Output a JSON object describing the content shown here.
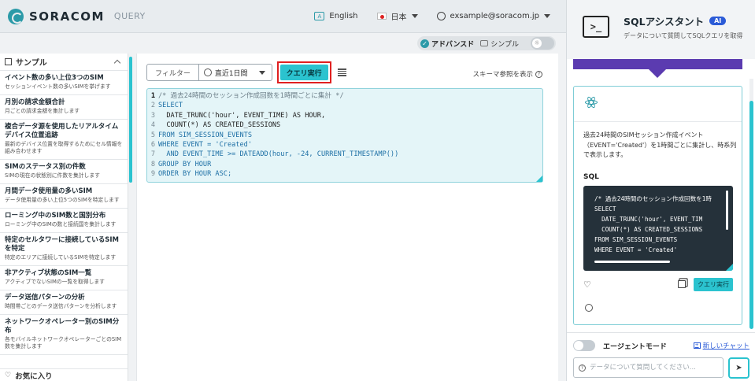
{
  "header": {
    "brand": "SORACOM",
    "product": "QUERY",
    "language": "English",
    "region": "日本",
    "user": "exsample@soracom.jp"
  },
  "mode": {
    "advanced_label": "アドバンスド",
    "simple_label": "シンプル",
    "selected": "advanced"
  },
  "sidebar": {
    "section_title": "サンプル",
    "items": [
      {
        "title": "イベント数の多い上位3つのSIM",
        "desc": "セッションイベント数の多いSIMを挙げます"
      },
      {
        "title": "月別の請求金額合計",
        "desc": "月ごとの請求金額を集計します"
      },
      {
        "title": "複合データ源を使用したリアルタイムデバイス位置追跡",
        "desc": "最新のデバイス位置を取得するためにセル情報を組み合わせます"
      },
      {
        "title": "SIMのステータス別の件数",
        "desc": "SIMの現在の状態別に件数を集計します"
      },
      {
        "title": "月間データ使用量の多いSIM",
        "desc": "データ使用量の多い上位5つのSIMを特定します"
      },
      {
        "title": "ローミング中のSIM数と国別分布",
        "desc": "ローミング中のSIMの数と接続国を集計します"
      },
      {
        "title": "特定のセルタワーに接続しているSIMを特定",
        "desc": "特定のエリアに接続しているSIMを特定します"
      },
      {
        "title": "非アクティブ状態のSIM一覧",
        "desc": "アクティブでないSIMの一覧を取得します"
      },
      {
        "title": "データ送信パターンの分析",
        "desc": "時間帯ごとのデータ送信パターンを分析します"
      },
      {
        "title": "ネットワークオペレーター別のSIM分布",
        "desc": "各モバイルネットワークオペレーターごとのSIM数を集計します"
      }
    ],
    "favorites_label": "お気に入り"
  },
  "toolbar": {
    "filter_label": "フィルター",
    "range_value": "直近1日間",
    "run_label": "クエリ実行",
    "schema_label": "スキーマ参照を表示"
  },
  "editor": {
    "lines": [
      "/* 過去24時間のセッション作成回数を1時間ごとに集計 */",
      "SELECT",
      "  DATE_TRUNC('hour', EVENT_TIME) AS HOUR,",
      "  COUNT(*) AS CREATED_SESSIONS",
      "FROM SIM_SESSION_EVENTS",
      "WHERE EVENT = 'Created'",
      "  AND EVENT_TIME >= DATEADD(hour, -24, CURRENT_TIMESTAMP())",
      "GROUP BY HOUR",
      "ORDER BY HOUR ASC;"
    ]
  },
  "assistant": {
    "title": "SQLアシスタント",
    "badge": "AI",
    "subtitle": "データについて質問してSQLクエリを取得",
    "answer_text": "過去24時間のSIMセッション作成イベント（EVENT='Created'）を1時間ごとに集計し、時系列で表示します。",
    "sql_label": "SQL",
    "sql_preview": "/* 過去24時間のセッション作成回数を1時\nSELECT\n  DATE_TRUNC('hour', EVENT_TIM\n  COUNT(*) AS CREATED_SESSIONS\nFROM SIM_SESSION_EVENTS\nWHERE EVENT = 'Created'",
    "run_label": "クエリ実行",
    "agent_mode_label": "エージェントモード",
    "new_chat_label": "新しいチャット",
    "input_placeholder": "データについて質問してください..."
  }
}
